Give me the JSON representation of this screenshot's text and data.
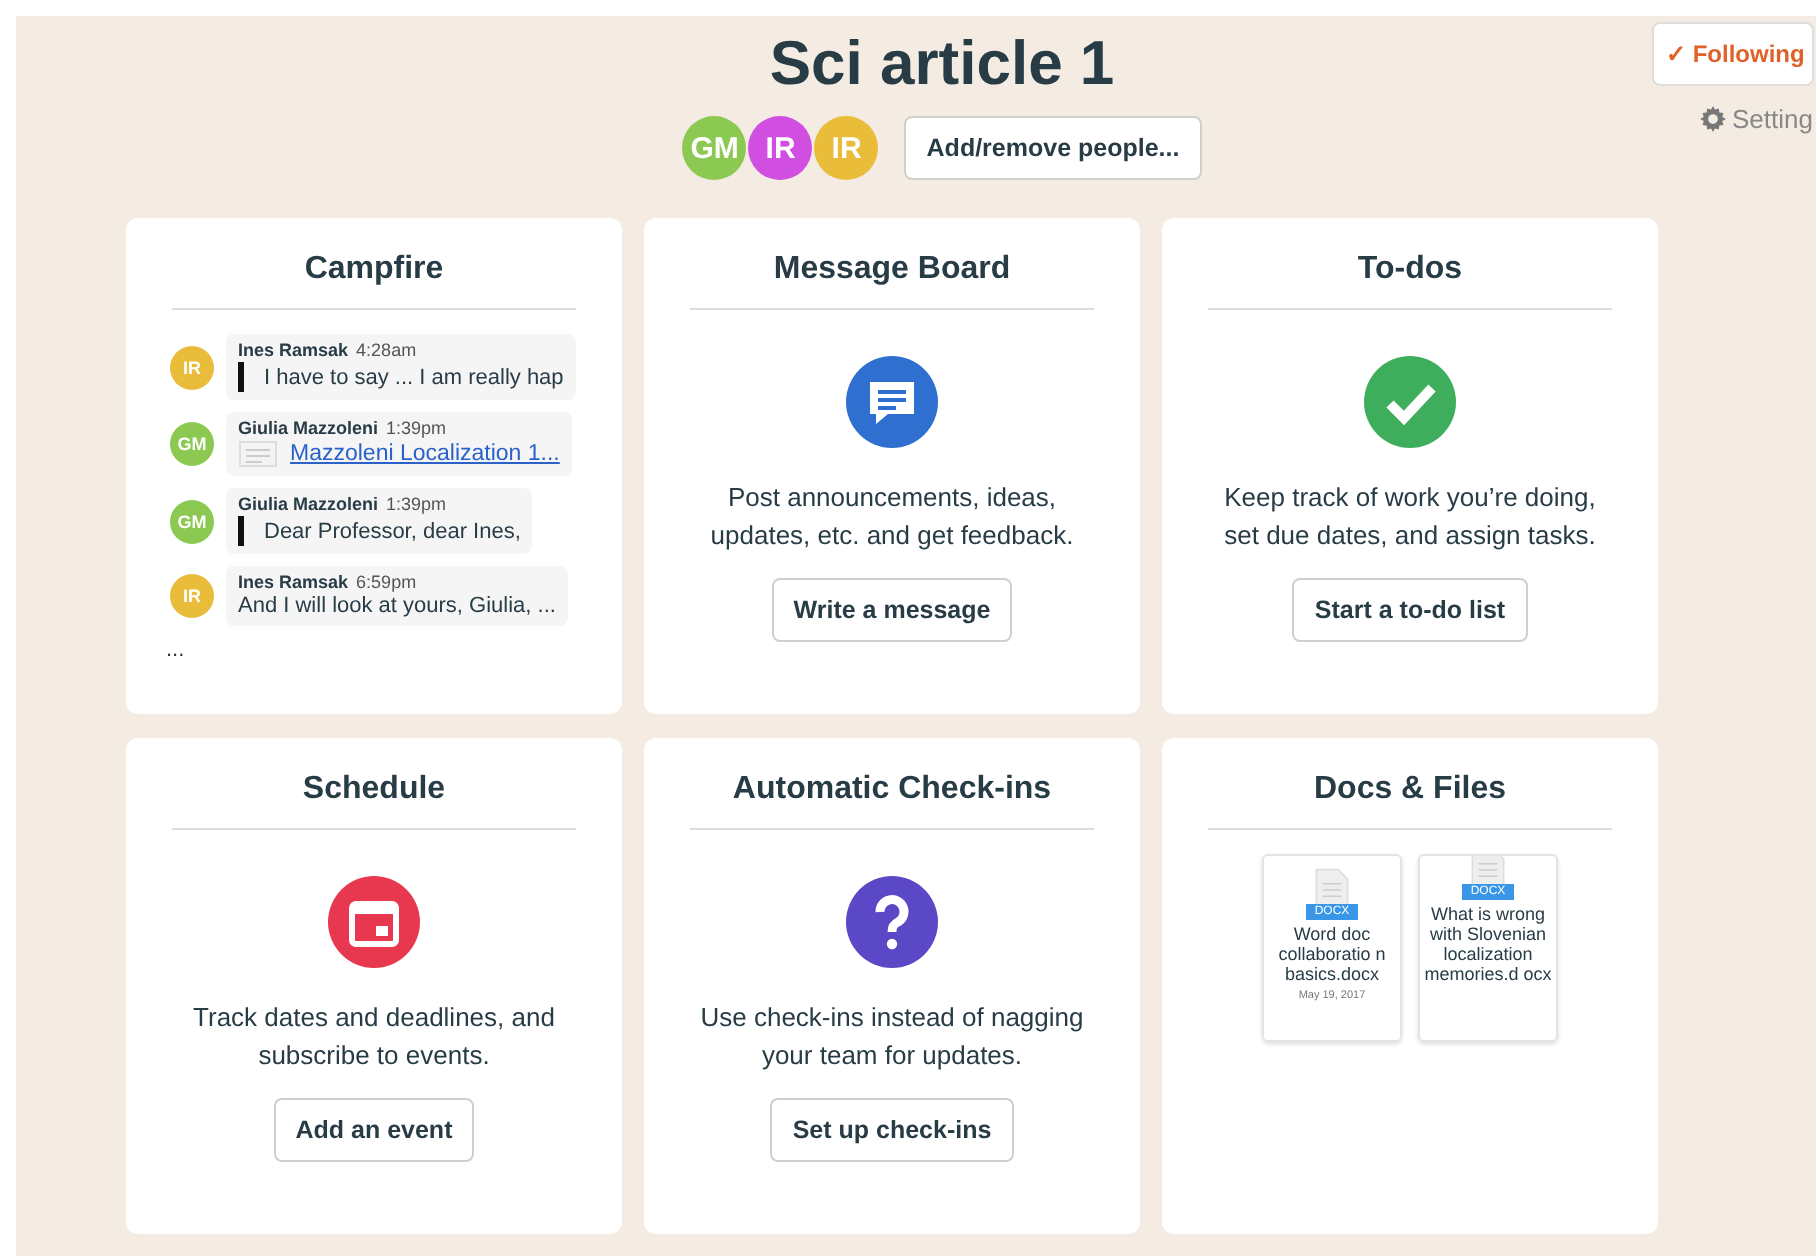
{
  "header": {
    "title": "Sci article 1",
    "people": [
      {
        "initials": "GM",
        "color": "#8cc952"
      },
      {
        "initials": "IR",
        "color": "#d14fe0"
      },
      {
        "initials": "IR",
        "color": "#e9bd3a"
      }
    ],
    "manage_button": "Add/remove people...",
    "follow_button": "✓ Following",
    "settings_link": "Setting"
  },
  "cards": [
    {
      "kind": "campfire",
      "title": "Campfire",
      "messages": [
        {
          "kind": "quote",
          "initials": "IR",
          "color": "#e9bd3a",
          "author": "Ines Ramsak",
          "time": "4:28am",
          "text": "I have to say ... I am really hap"
        },
        {
          "kind": "file",
          "initials": "GM",
          "color": "#8cc952",
          "author": "Giulia Mazzoleni",
          "time": "1:39pm",
          "text": "Mazzoleni Localization 1..."
        },
        {
          "kind": "quote",
          "initials": "GM",
          "color": "#8cc952",
          "author": "Giulia Mazzoleni",
          "time": "1:39pm",
          "text": "Dear Professor, dear Ines,"
        },
        {
          "kind": "text",
          "initials": "IR",
          "color": "#e9bd3a",
          "author": "Ines Ramsak",
          "time": "6:59pm",
          "text": "And I will look at yours, Giulia, ..."
        }
      ],
      "more": "..."
    },
    {
      "kind": "message",
      "title": "Message Board",
      "description": "Post announcements, ideas, updates, etc. and get feedback.",
      "button": "Write a message"
    },
    {
      "kind": "todo",
      "title": "To-dos",
      "description": "Keep track of work you’re doing, set due dates, and assign tasks.",
      "button": "Start a to-do list"
    },
    {
      "kind": "schedule",
      "title": "Schedule",
      "description": "Track dates and deadlines, and subscribe to events.",
      "button": "Add an event"
    },
    {
      "kind": "checkin",
      "title": "Automatic Check-ins",
      "description": "Use check-ins instead of nagging your team for updates.",
      "button": "Set up check-ins"
    },
    {
      "kind": "docs",
      "title": "Docs & Files",
      "files": [
        {
          "badge": "DOCX",
          "name": "Word doc collaboratio n basics.docx",
          "date": "May 19, 2017",
          "raised": false
        },
        {
          "badge": "DOCX",
          "name": "What is wrong with Slovenian localization memories.d ocx",
          "raised": true
        }
      ]
    }
  ]
}
